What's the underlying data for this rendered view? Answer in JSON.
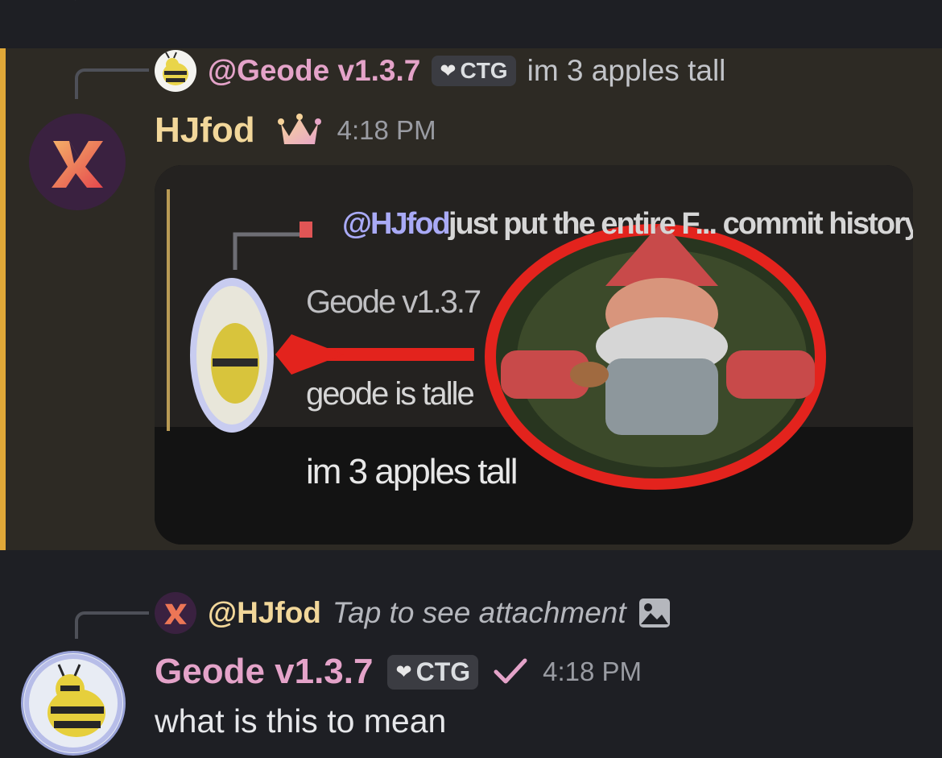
{
  "colors": {
    "background": "#1e1f24",
    "highlight_background": "#2d2a24",
    "highlight_bar": "#e0a838",
    "geode_name": "#e4a3c9",
    "hjfod_name": "#f2d79a",
    "tag_background": "#3b3c42"
  },
  "message_1": {
    "reply": {
      "mention": "@Geode v1.3.7",
      "tag": "CTG",
      "tag_icon": "heart-icon",
      "text": "im 3 apples tall"
    },
    "author": "HJfod",
    "author_badge": "crown-icon",
    "time": "4:18 PM",
    "attachment": {
      "type": "image",
      "visible_text": {
        "mention": "@HJfod",
        "line1": "just put the entire F... commit history in c",
        "name": "Geode v1.3.7",
        "line2": "geode is talle",
        "line3": "im 3 apples tall"
      },
      "subject": "garden gnome circled in red with arrow"
    }
  },
  "message_2": {
    "reply": {
      "mention": "@HJfod",
      "text": "Tap to see attachment",
      "icon": "image-icon"
    },
    "author": "Geode v1.3.7",
    "tag": "CTG",
    "tag_icon": "heart-icon",
    "verified_icon": "checkmark-icon",
    "time": "4:18 PM",
    "text": "what is this to mean"
  }
}
